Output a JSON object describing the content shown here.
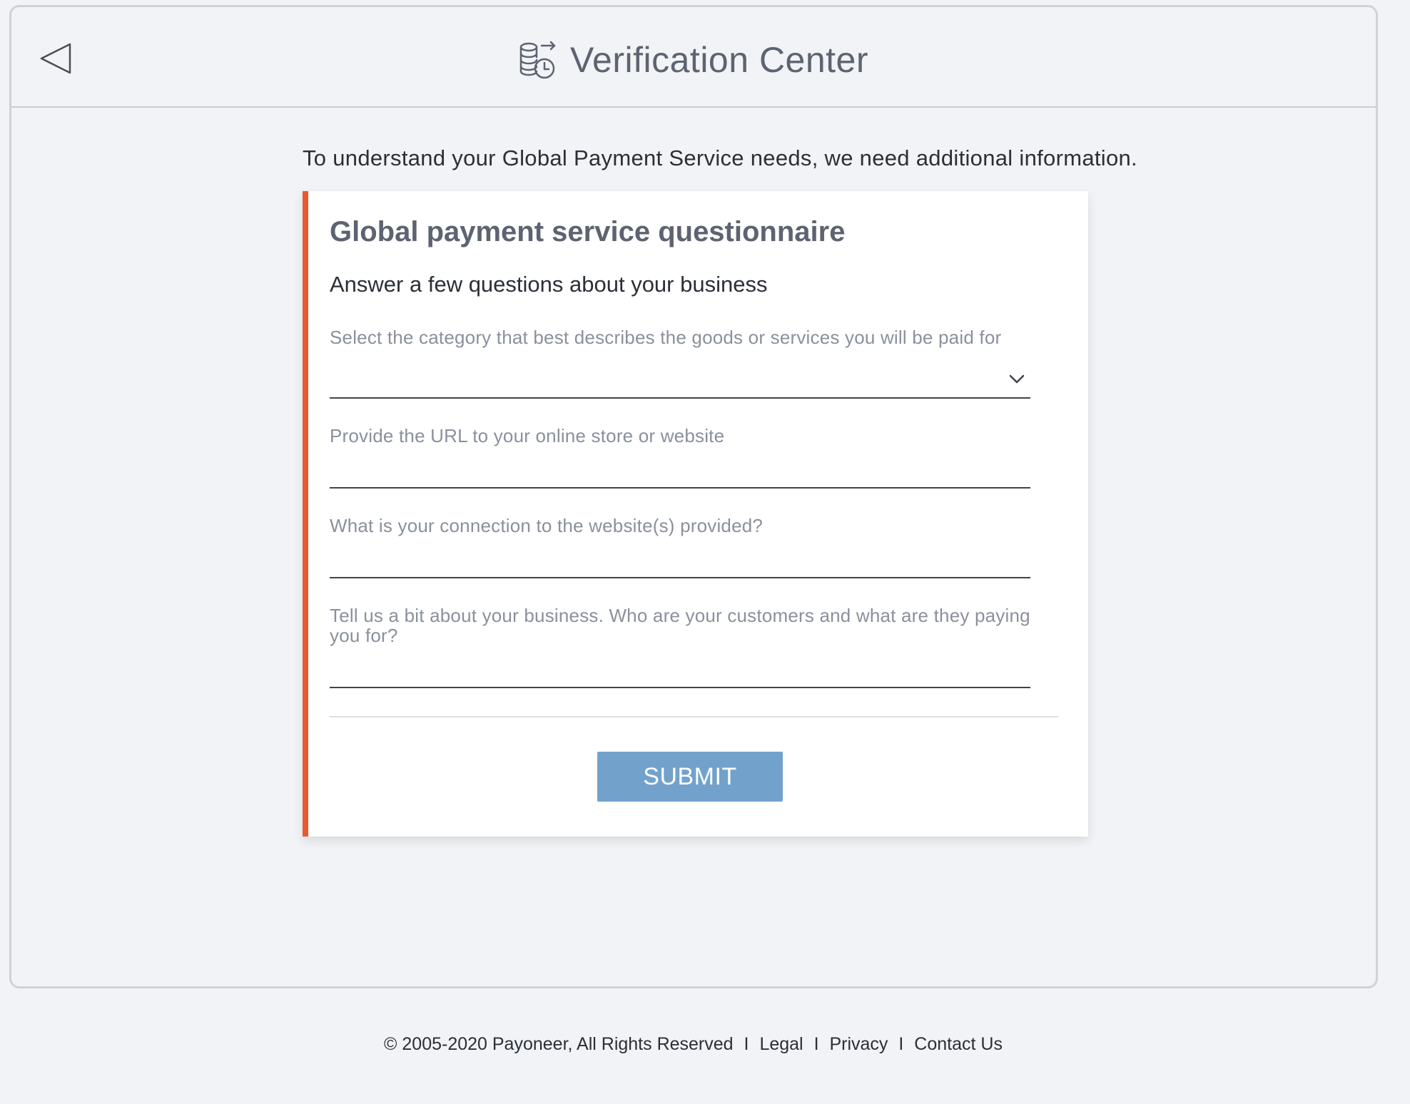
{
  "header": {
    "title": "Verification Center",
    "back_icon": "back-triangle-icon",
    "title_icon": "coins-clock-icon"
  },
  "intro_text": "To understand your Global Payment Service needs, we need additional information.",
  "card": {
    "accent_color": "#ea5a2f",
    "title": "Global payment service questionnaire",
    "subtitle": "Answer a few questions about your business",
    "fields": {
      "category": {
        "label": "Select the category that best describes the goods or services you will be paid for",
        "value": ""
      },
      "url": {
        "label": "Provide the URL to your online store or website",
        "value": ""
      },
      "connection": {
        "label": "What is your connection to the website(s) provided?",
        "value": ""
      },
      "business": {
        "label": "Tell us a bit about your business. Who are your customers and what are they paying you for?",
        "value": ""
      }
    },
    "submit_label": "SUBMIT",
    "submit_color": "#72a2cc"
  },
  "footer": {
    "copyright": "© 2005-2020 Payoneer, All Rights Reserved",
    "separator": "I",
    "links": {
      "legal": "Legal",
      "privacy": "Privacy",
      "contact": "Contact Us"
    }
  }
}
